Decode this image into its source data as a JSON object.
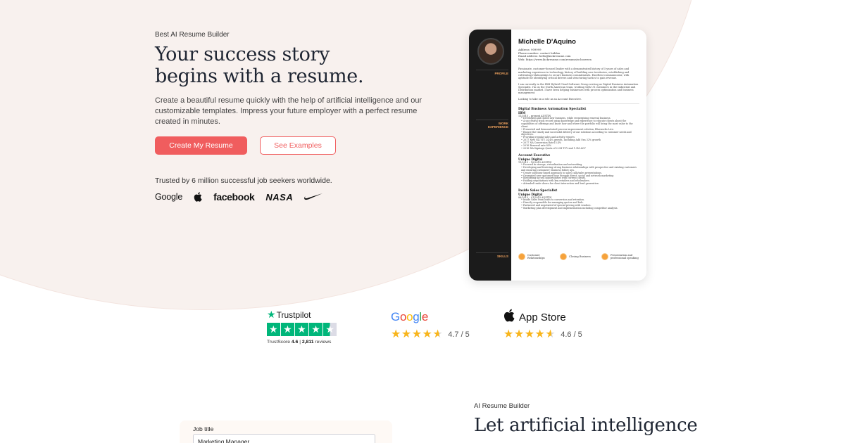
{
  "hero": {
    "eyebrow": "Best AI Resume Builder",
    "title_line1": "Your success story",
    "title_line2": "begins with a resume.",
    "description": "Create a beautiful resume quickly with the help of artificial intelligence and our customizable templates. Impress your future employer with a perfect resume created in minutes.",
    "primary_button": "Create My Resume",
    "secondary_button": "See Examples",
    "trusted_text": "Trusted by 6 million successful job seekers worldwide.",
    "logos": {
      "google": "Google",
      "apple": "",
      "facebook": "facebook",
      "nasa": "NASA",
      "nike": "nike"
    }
  },
  "resume": {
    "name": "Michelle D'Aquino",
    "address": "Address:  909999",
    "phone": "Phone number:  contact hidden",
    "email": "Email address:  hello@kickresume.com",
    "web": "Web:  https://www.kickresume.com/resume/m-bosveen",
    "sidebar_labels": {
      "profile": "PROFILE",
      "work_experience_1": "WORK",
      "work_experience_2": "EXPERIENCE",
      "skills": "SKILLS"
    },
    "profile_p1": "Passionate, customer-focused leader with a demonstrated history of 5 years of sales and marketing experience in technology, history of building new territories, establishing and cultivating relationships to secure business commitments. Excellent communicator, with aptitude for identifying critical drivers and structuring tactics to gain revenue.",
    "profile_p2": "I am currently in the IBM Hybrid Cloud Software Group serving as Digital Business Automation Specialist. I'm on the North American team, working with US customers in the Industrial and Distribution market. I have been helping businesses with process optimization and business management.",
    "profile_p3": "Looking to take on a role as an Account Executive.",
    "jobs": [
      {
        "title": "Digital Business Automation Specialist",
        "company": "IBM",
        "date": "11/2015 – present  AUSTIN",
        "bullets": [
          "Developed and closed new business, while reenergizing renewal business.",
          "A successful track record using knowledge and experience to educate clients about the capabilities of offerings and know how and where the portfolio will bring the most value to the client.",
          "Presented and demonstrated process improvement solution, Blueworks Live.",
          "Ensure the timely and successful delivery of our solutions according to customer needs and objectives.",
          "Providing regular sales and activity reports",
          "2017 New NA YTY 24.4% growth, Including Add Ons 32% growth",
          "2017 NA Conversion Rate15.4%",
          "2016 Renewal rate 85%",
          "2016 NA Signings Quota of 2.2M TCV and 1.9M ACV"
        ]
      },
      {
        "title": "Account Executive",
        "company": "Unique Digital",
        "date": "11/2013 – 10/2015  AUSTIN",
        "bullets": [
          "Focused in storage, virtualization and networking",
          "Developing and fostering strong business relationships with prospective and existing customers and ensuring customers' business follow ups.",
          "Create solutions-based approach to sales calls/sales presentations.",
          "Generated new customer base through direct, social and network marketing",
          "Identifying up-sell opportunities with current clients.",
          "Holding negotiations with key retailers and wholesalers.",
          "Attended trade shows for client interaction and lead generation."
        ]
      },
      {
        "title": "Inside Sales Specialist",
        "company": "Unique Digital",
        "date": "06/2013 – 01/2015  AUSTIN",
        "bullets": [
          "Inside Sales from leads to conversion and retention.",
          "Directly responsible for managing quotes and bids.",
          "Partnered and negotiated of special pricing with vendors.",
          "Marketing plan development and implementation including competitor analysis."
        ]
      }
    ],
    "skills": [
      "Customer Relationships",
      "Closing Business",
      "Presentation and professional speaking"
    ]
  },
  "ratings": {
    "trustpilot": {
      "brand": "Trustpilot",
      "score_label": "TrustScore",
      "score": "4.6",
      "separator": "|",
      "reviews": "2,811",
      "reviews_label": "reviews",
      "value": 4.6
    },
    "google": {
      "brand": "Google",
      "score": "4.7 / 5",
      "value": 4.7
    },
    "appstore": {
      "brand": "App Store",
      "score": "4.6 / 5",
      "value": 4.6
    }
  },
  "section2": {
    "eyebrow": "AI Resume Builder",
    "title": "Let artificial intelligence",
    "form_label": "Job title",
    "form_value": "Marketing Manager"
  },
  "colors": {
    "accent": "#f05d5e",
    "trustpilot_green": "#00b67a",
    "star_yellow": "#f8b51c",
    "hero_bg": "#f8f1ee",
    "resume_sidebar": "#1b1b1b",
    "skill_orange": "#f6a23b"
  },
  "icons": {
    "apple": "apple-icon",
    "nike": "nike-swoosh-icon",
    "trustpilot": "trustpilot-star-icon",
    "star": "star-icon"
  }
}
